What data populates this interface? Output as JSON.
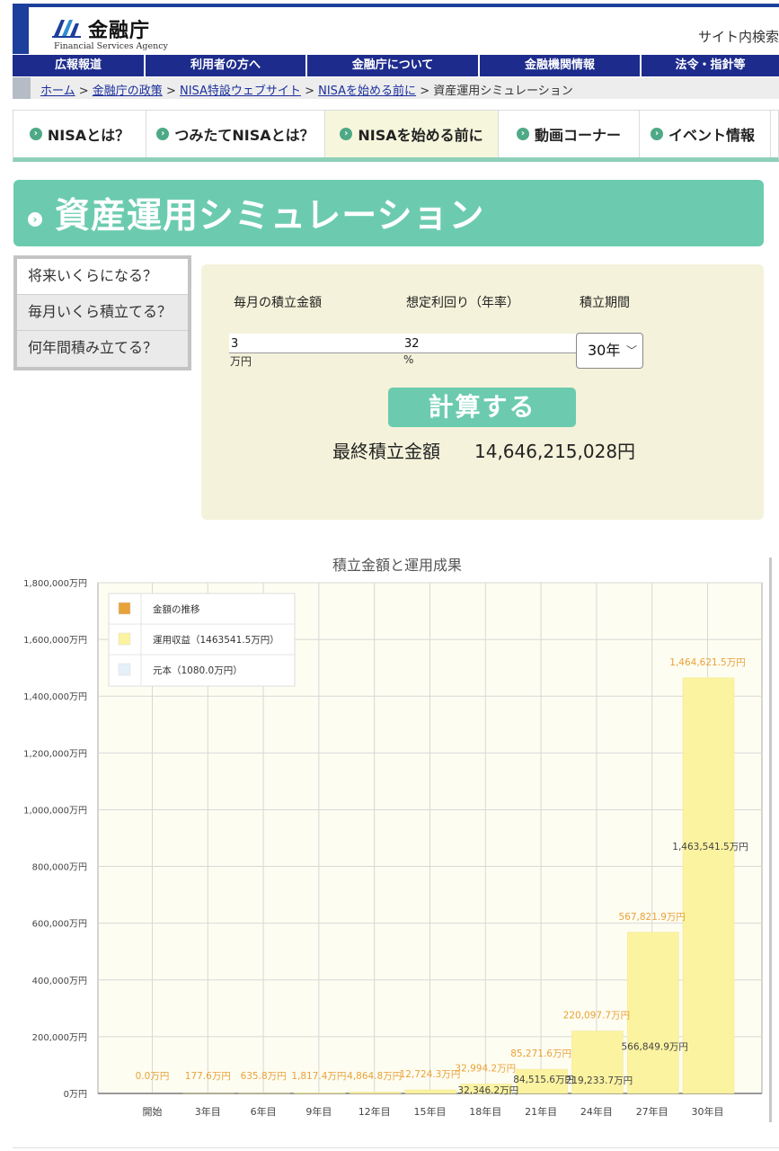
{
  "header": {
    "logo_text": "金融庁",
    "logo_subtext": "Financial Services Agency",
    "site_search": "サイト内検索"
  },
  "global_nav": [
    {
      "label": "広報報道"
    },
    {
      "label": "利用者の方へ"
    },
    {
      "label": "金融庁について"
    },
    {
      "label": "金融機関情報"
    },
    {
      "label": "法令・指針等"
    }
  ],
  "breadcrumb": {
    "links": [
      "ホーム",
      "金融庁の政策",
      "NISA特設ウェブサイト",
      "NISAを始める前に"
    ],
    "current": "資産運用シミュレーション",
    "separator": " > "
  },
  "sub_nav": [
    {
      "label": "NISAとは？",
      "active": false
    },
    {
      "label": "つみたてNISAとは？",
      "active": false
    },
    {
      "label": "NISAを始める前に",
      "active": true
    },
    {
      "label": "動画コーナー",
      "active": false
    },
    {
      "label": "イベント情報",
      "active": false
    }
  ],
  "page_title": "資産運用シミュレーション",
  "mode_tabs": [
    {
      "label": "将来いくらになる？",
      "active": true
    },
    {
      "label": "毎月いくら積立てる？",
      "active": false
    },
    {
      "label": "何年間積み立てる？",
      "active": false
    }
  ],
  "form": {
    "monthly_label": "毎月の積立金額",
    "monthly_value": "3",
    "monthly_unit": "万円",
    "rate_label": "想定利回り（年率）",
    "rate_value": "32",
    "rate_unit": "%",
    "period_label": "積立期間",
    "period_value": "30年",
    "calc_button": "計算する",
    "result_label": "最終積立金額",
    "result_value": "14,646,215,028円"
  },
  "colors": {
    "brand_navy": "#1d2c8c",
    "accent_green": "#6ccbaf",
    "panel_bg": "#f4f2da",
    "series_total": "#e8a23a",
    "series_profit": "#fbf3a0",
    "series_principal": "#e6f0f8"
  },
  "chart_data": {
    "type": "bar",
    "title": "積立金額と運用成果",
    "ylim": [
      0,
      1800000
    ],
    "y_ticks": [
      "0万円",
      "200,000万円",
      "400,000万円",
      "600,000万円",
      "800,000万円",
      "1,000,000万円",
      "1,200,000万円",
      "1,400,000万円",
      "1,600,000万円",
      "1,800,000万円"
    ],
    "categories": [
      "開始",
      "3年目",
      "6年目",
      "9年目",
      "12年目",
      "15年目",
      "18年目",
      "21年目",
      "24年目",
      "27年目",
      "30年目"
    ],
    "legend": [
      "金額の推移",
      "運用収益（1463541.5万円）",
      "元本（1080.0万円）"
    ],
    "series": [
      {
        "name": "金額の推移",
        "values": [
          0.0,
          177.6,
          635.8,
          1817.4,
          4864.8,
          12724.3,
          32994.2,
          85271.6,
          220097.7,
          567821.9,
          1464621.5
        ],
        "labels": [
          "0.0万円",
          "177.6万円",
          "635.8万円",
          "1,817.4万円",
          "4,864.8万円",
          "12,724.3万円",
          "32,994.2万円",
          "85,271.6万円",
          "220,097.7万円",
          "567,821.9万円",
          "1,464,621.5万円"
        ]
      },
      {
        "name": "運用収益",
        "values": [
          null,
          null,
          null,
          null,
          null,
          null,
          32346.2,
          84515.6,
          219233.7,
          566849.9,
          1463541.5
        ],
        "labels": [
          "",
          "",
          "",
          "",
          "",
          "",
          "32,346.2万円",
          "84,515.6万円",
          "219,233.7万円",
          "566,849.9万円",
          "1,463,541.5万円"
        ]
      }
    ]
  }
}
